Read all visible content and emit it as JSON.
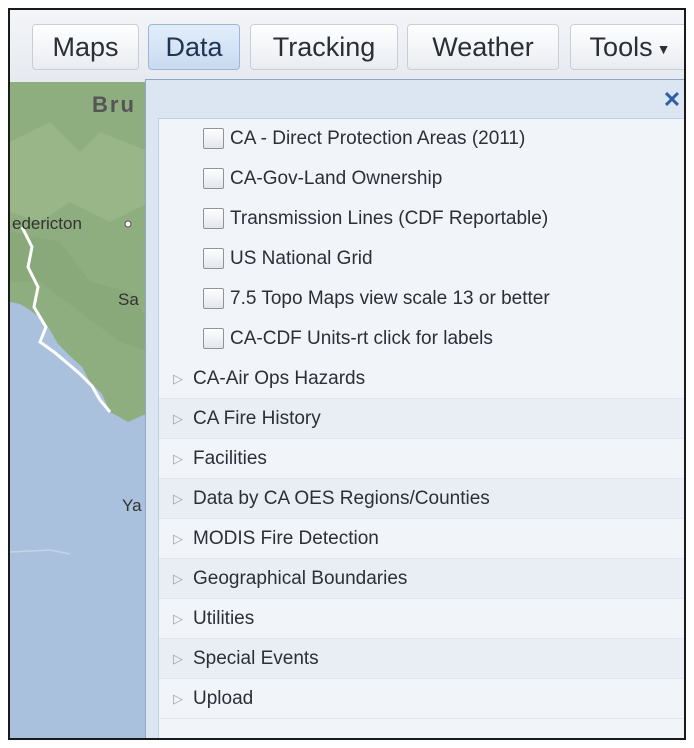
{
  "toolbar": {
    "tabs": [
      {
        "label": "Maps"
      },
      {
        "label": "Data"
      },
      {
        "label": "Tracking"
      },
      {
        "label": "Weather"
      },
      {
        "label": "Tools"
      }
    ],
    "active_tab": "Data"
  },
  "map": {
    "labels": [
      "Bru",
      "edericton",
      "Sa",
      "Ya"
    ],
    "colors": {
      "land": "#8fae7f",
      "water": "#a9c1dd",
      "coast": "#ffffff"
    }
  },
  "panel": {
    "close_icon": "close-icon",
    "checkbox_layers": [
      {
        "label": "CA - Direct Protection Areas (2011)",
        "checked": false
      },
      {
        "label": "CA-Gov-Land Ownership",
        "checked": false
      },
      {
        "label": "Transmission Lines (CDF Reportable)",
        "checked": false
      },
      {
        "label": "US National Grid",
        "checked": false
      },
      {
        "label": "7.5 Topo Maps view scale 13 or better",
        "checked": false
      },
      {
        "label": "CA-CDF Units-rt click for labels",
        "checked": false
      }
    ],
    "groups": [
      {
        "label": "CA-Air Ops Hazards"
      },
      {
        "label": "CA Fire History"
      },
      {
        "label": "Facilities"
      },
      {
        "label": "Data by CA OES Regions/Counties"
      },
      {
        "label": "MODIS Fire Detection"
      },
      {
        "label": "Geographical Boundaries"
      },
      {
        "label": "Utilities"
      },
      {
        "label": "Special Events"
      },
      {
        "label": "Upload"
      }
    ]
  }
}
